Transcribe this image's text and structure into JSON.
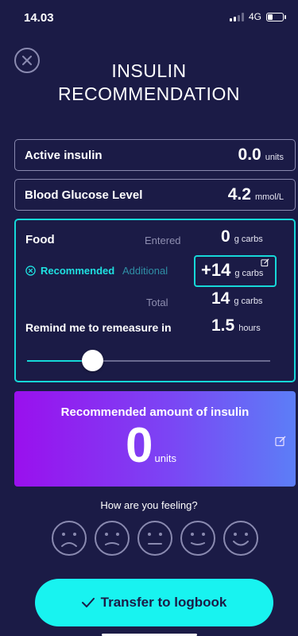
{
  "status": {
    "time": "14.03",
    "network": "4G"
  },
  "header": {
    "title_line1": "INSULIN",
    "title_line2": "RECOMMENDATION"
  },
  "active_insulin": {
    "label": "Active insulin",
    "value": "0.0",
    "unit": "units"
  },
  "blood_glucose": {
    "label": "Blood Glucose Level",
    "value": "4.2",
    "unit": "mmol/L"
  },
  "food": {
    "label": "Food",
    "entered_label": "Entered",
    "entered_value": "0",
    "entered_unit": "g carbs",
    "recommended_label": "Recommended",
    "additional_label": "Additional",
    "additional_value": "+14",
    "additional_unit": "g carbs",
    "total_label": "Total",
    "total_value": "14",
    "total_unit": "g carbs",
    "remind_label": "Remind me to remeasure in",
    "remind_value": "1.5",
    "remind_unit": "hours",
    "slider_fraction": 0.27
  },
  "recommendation": {
    "title": "Recommended amount of insulin",
    "value": "0",
    "unit": "units"
  },
  "feeling": {
    "question": "How are you feeling?",
    "faces": [
      "very-sad-face-icon",
      "sad-face-icon",
      "neutral-face-icon",
      "slight-smile-face-icon",
      "happy-face-icon"
    ]
  },
  "cta": {
    "label": "Transfer to logbook"
  },
  "colors": {
    "background": "#1b1b46",
    "accent": "#16d8d8",
    "cta": "#18f3f0",
    "gradient_start": "#9a10ee",
    "gradient_end": "#5c7ef7"
  }
}
